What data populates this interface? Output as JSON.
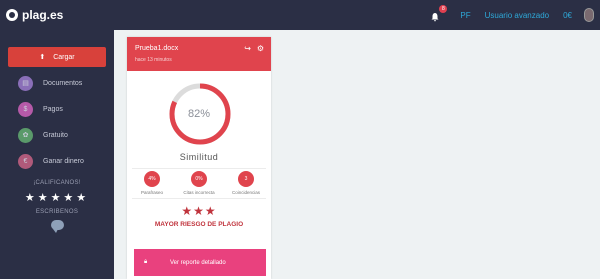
{
  "header": {
    "logo_text": "plag.es",
    "notification_count": "8",
    "user_initials": "PF",
    "plan": "Usuario avanzado",
    "balance": "0€"
  },
  "sidebar": {
    "upload_label": "Cargar",
    "items": [
      {
        "label": "Documentos",
        "icon": "documents-icon",
        "color": "#8a6fb8"
      },
      {
        "label": "Pagos",
        "icon": "payments-icon",
        "color": "#b55aa8"
      },
      {
        "label": "Gratuito",
        "icon": "free-icon",
        "color": "#5a9a6a"
      },
      {
        "label": "Ganar dinero",
        "icon": "money-icon",
        "color": "#b05a7a"
      }
    ],
    "rate_label": "¡CALIFICANOS!",
    "stars": "★★★★★",
    "write_label": "ESCRIBENOS"
  },
  "card": {
    "filename": "Prueba1.docx",
    "time_ago": "hace 13 minutos",
    "percent_value": 82,
    "percent_label": "82%",
    "similarity_label": "Similitud",
    "metrics": [
      {
        "value": "4%",
        "label": "Parafraseo"
      },
      {
        "value": "0%",
        "label": "Citas incorrecta"
      },
      {
        "value": "3",
        "label": "Coincidencias"
      }
    ],
    "risk_stars": "★★★",
    "risk_label": "MAYOR RIESGO DE PLAGIO",
    "report_button": "Ver reporte detallado"
  },
  "colors": {
    "accent_red": "#e0444d",
    "report_pink": "#e9417e",
    "sidebar_bg": "#2b2f45",
    "link_blue": "#2ea8d8"
  }
}
